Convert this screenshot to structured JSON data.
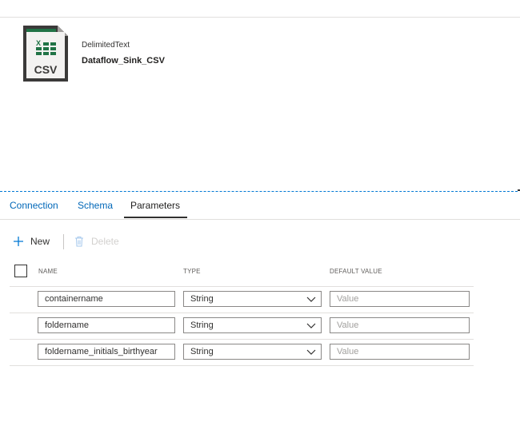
{
  "dataset": {
    "type_label": "DelimitedText",
    "name": "Dataflow_Sink_CSV",
    "icon_label": "CSV",
    "icon_badge": "X",
    "icon_name": "csv-file-icon"
  },
  "tabs": [
    {
      "label": "Connection",
      "active": false
    },
    {
      "label": "Schema",
      "active": false
    },
    {
      "label": "Parameters",
      "active": true
    }
  ],
  "toolbar": {
    "new_label": "New",
    "delete_label": "Delete",
    "new_icon": "plus-icon",
    "delete_icon": "trash-icon"
  },
  "grid": {
    "headers": {
      "name": "NAME",
      "type": "TYPE",
      "default_value": "DEFAULT VALUE"
    },
    "value_placeholder": "Value",
    "rows": [
      {
        "name": "containername",
        "type": "String"
      },
      {
        "name": "foldername",
        "type": "String"
      },
      {
        "name": "foldername_initials_birthyear",
        "type": "String"
      }
    ]
  },
  "colors": {
    "accent": "#0078d4",
    "link": "#0067b8",
    "excel_green": "#217346",
    "icon_dark": "#3b3a39"
  }
}
